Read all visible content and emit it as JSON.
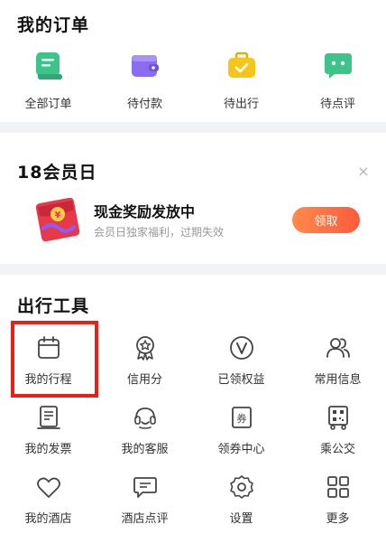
{
  "orders_section": {
    "title": "我的订单",
    "items": [
      {
        "label": "全部订单",
        "icon": "all-orders-icon",
        "color": "#3cc48a"
      },
      {
        "label": "待付款",
        "icon": "wallet-icon",
        "color": "#8a6cf0"
      },
      {
        "label": "待出行",
        "icon": "suitcase-icon",
        "color": "#f5c518"
      },
      {
        "label": "待点评",
        "icon": "chat-bubble-icon",
        "color": "#3cc48a"
      }
    ]
  },
  "promo_section": {
    "title": "18会员日",
    "close": "×",
    "headline": "现金奖励发放中",
    "subtext": "会员日独家福利，过期失效",
    "button": "领取",
    "accent": "#ff6a3c"
  },
  "tools_section": {
    "title": "出行工具",
    "rows": [
      [
        {
          "label": "我的行程",
          "icon": "calendar-icon"
        },
        {
          "label": "信用分",
          "icon": "credit-badge-icon"
        },
        {
          "label": "已领权益",
          "icon": "vip-v-icon"
        },
        {
          "label": "常用信息",
          "icon": "contacts-icon"
        }
      ],
      [
        {
          "label": "我的发票",
          "icon": "invoice-icon"
        },
        {
          "label": "我的客服",
          "icon": "customer-service-icon"
        },
        {
          "label": "领券中心",
          "icon": "coupon-icon"
        },
        {
          "label": "乘公交",
          "icon": "bus-qr-icon"
        }
      ],
      [
        {
          "label": "我的酒店",
          "icon": "heart-icon"
        },
        {
          "label": "酒店点评",
          "icon": "review-icon"
        },
        {
          "label": "设置",
          "icon": "settings-gear-icon"
        },
        {
          "label": "更多",
          "icon": "grid-more-icon"
        }
      ]
    ]
  },
  "highlight_color": "#e8201a"
}
